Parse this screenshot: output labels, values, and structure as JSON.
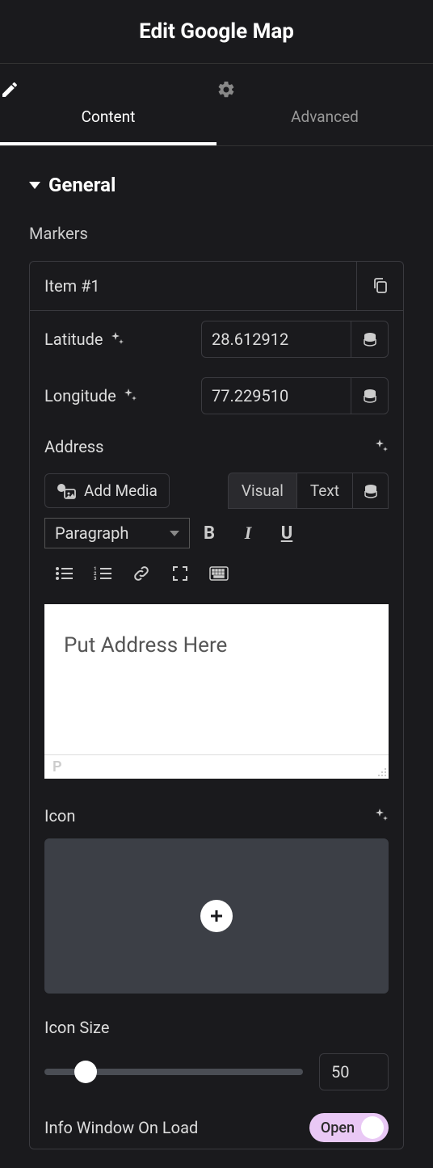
{
  "header": {
    "title": "Edit Google Map"
  },
  "tabs": {
    "content": "Content",
    "advanced": "Advanced",
    "active": "content"
  },
  "section": {
    "general": "General"
  },
  "markers": {
    "label": "Markers",
    "item_title": "Item #1",
    "latitude_label": "Latitude",
    "latitude_value": "28.612912",
    "longitude_label": "Longitude",
    "longitude_value": "77.229510",
    "address_label": "Address",
    "add_media": "Add Media",
    "visual_tab": "Visual",
    "text_tab": "Text",
    "paragraph": "Paragraph",
    "editor_content": "Put Address Here",
    "path_p": "P",
    "icon_label": "Icon",
    "icon_size_label": "Icon Size",
    "icon_size_value": "50",
    "info_window_label": "Info Window On Load",
    "toggle_open": "Open"
  }
}
